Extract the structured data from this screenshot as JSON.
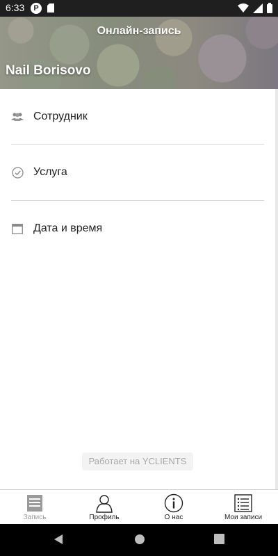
{
  "status_bar": {
    "time": "6:33",
    "left_icons": [
      "p-badge-icon",
      "sd-card-icon"
    ],
    "right_icons": [
      "wifi-icon",
      "signal-icon",
      "battery-icon"
    ]
  },
  "header": {
    "title": "Онлайн-запись",
    "salon_name": "Nail Borisovo"
  },
  "menu": [
    {
      "label": "Сотрудник",
      "icon": "people-icon"
    },
    {
      "label": "Услуга",
      "icon": "check-circle-icon"
    },
    {
      "label": "Дата и время",
      "icon": "calendar-icon"
    }
  ],
  "powered_by": "Работает на YCLIENTS",
  "bottom_nav": [
    {
      "label": "Запись",
      "icon": "document-icon",
      "active": true
    },
    {
      "label": "Профиль",
      "icon": "person-icon",
      "active": false
    },
    {
      "label": "О нас",
      "icon": "info-icon",
      "active": false
    },
    {
      "label": "Мои записи",
      "icon": "list-icon",
      "active": false
    }
  ],
  "system_nav": [
    "back-icon",
    "home-icon",
    "recents-icon"
  ],
  "colors": {
    "status_bar": "#1f1f1f",
    "text": "#222222",
    "divider": "#d9d9d9",
    "muted": "#a8a8a8",
    "active_tab": "#999999"
  }
}
